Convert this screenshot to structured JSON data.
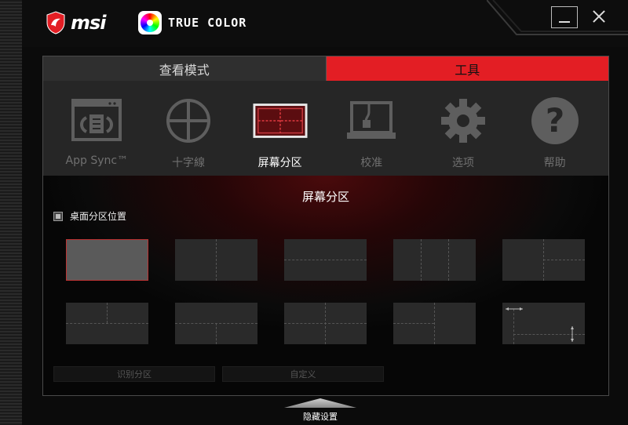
{
  "app": {
    "brand": "msi",
    "product": "TRUE COLOR"
  },
  "tabs": [
    {
      "label": "查看模式",
      "active": false
    },
    {
      "label": "工具",
      "active": true
    }
  ],
  "tools": [
    {
      "label": "App Sync™",
      "icon": "app-sync-icon",
      "active": false
    },
    {
      "label": "十字線",
      "icon": "crosshair-icon",
      "active": false
    },
    {
      "label": "屏幕分区",
      "icon": "screen-split-icon",
      "active": true
    },
    {
      "label": "校准",
      "icon": "laptop-calibrate-icon",
      "active": false
    },
    {
      "label": "选项",
      "icon": "gear-icon",
      "active": false
    },
    {
      "label": "帮助",
      "icon": "help-icon",
      "active": false
    }
  ],
  "content": {
    "title": "屏幕分区",
    "desktop_split_label": "桌面分区位置",
    "desktop_split_checked": true,
    "identify_button": "识别分区",
    "custom_button": "自定义",
    "selected_layout": 1
  },
  "footer": {
    "hide_settings": "隐藏设置"
  },
  "colors": {
    "accent": "#e31e24",
    "toolbar_bg": "#262626",
    "inactive_text": "#707070"
  }
}
